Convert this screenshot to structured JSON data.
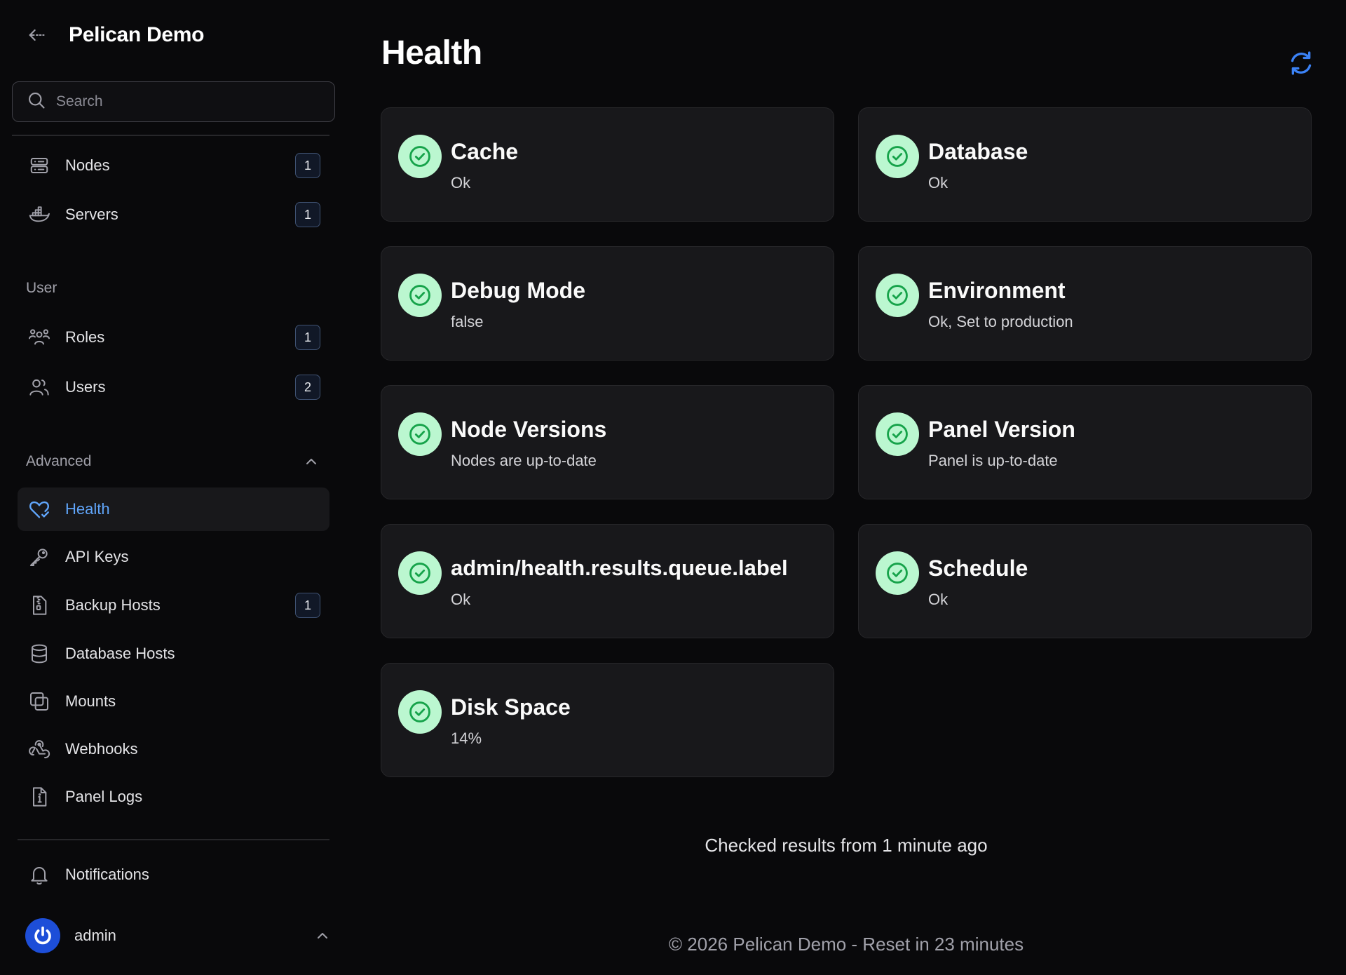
{
  "brand": {
    "title": "Pelican Demo"
  },
  "search": {
    "placeholder": "Search"
  },
  "nav": {
    "top": [
      {
        "label": "Nodes",
        "badge": "1"
      },
      {
        "label": "Servers",
        "badge": "1"
      }
    ],
    "user_group": {
      "label": "User",
      "items": [
        {
          "label": "Roles",
          "badge": "1"
        },
        {
          "label": "Users",
          "badge": "2"
        }
      ]
    },
    "advanced_group": {
      "label": "Advanced",
      "items": [
        {
          "label": "Health",
          "active": true
        },
        {
          "label": "API Keys"
        },
        {
          "label": "Backup Hosts",
          "badge": "1"
        },
        {
          "label": "Database Hosts"
        },
        {
          "label": "Mounts"
        },
        {
          "label": "Webhooks"
        },
        {
          "label": "Panel Logs"
        }
      ]
    },
    "notifications": {
      "label": "Notifications"
    }
  },
  "user": {
    "name": "admin"
  },
  "page": {
    "title": "Health"
  },
  "checks": [
    {
      "title": "Cache",
      "message": "Ok",
      "status": "ok"
    },
    {
      "title": "Database",
      "message": "Ok",
      "status": "ok"
    },
    {
      "title": "Debug Mode",
      "message": "false",
      "status": "ok"
    },
    {
      "title": "Environment",
      "message": "Ok, Set to production",
      "status": "ok"
    },
    {
      "title": "Node Versions",
      "message": "Nodes are up-to-date",
      "status": "ok"
    },
    {
      "title": "Panel Version",
      "message": "Panel is up-to-date",
      "status": "ok"
    },
    {
      "title": "admin/health.results.queue.label",
      "message": "Ok",
      "status": "ok"
    },
    {
      "title": "Schedule",
      "message": "Ok",
      "status": "ok"
    },
    {
      "title": "Disk Space",
      "message": "14%",
      "status": "ok"
    }
  ],
  "checked_text": "Checked results from 1 minute ago",
  "footer": {
    "text": "© 2026 Pelican Demo - Reset in 23 minutes"
  },
  "colors": {
    "accent": "#60a5fa",
    "status_ok_bg": "#bbf7d0",
    "status_ok_fg": "#16a34a",
    "background": "#09090b",
    "card": "#18181b"
  }
}
